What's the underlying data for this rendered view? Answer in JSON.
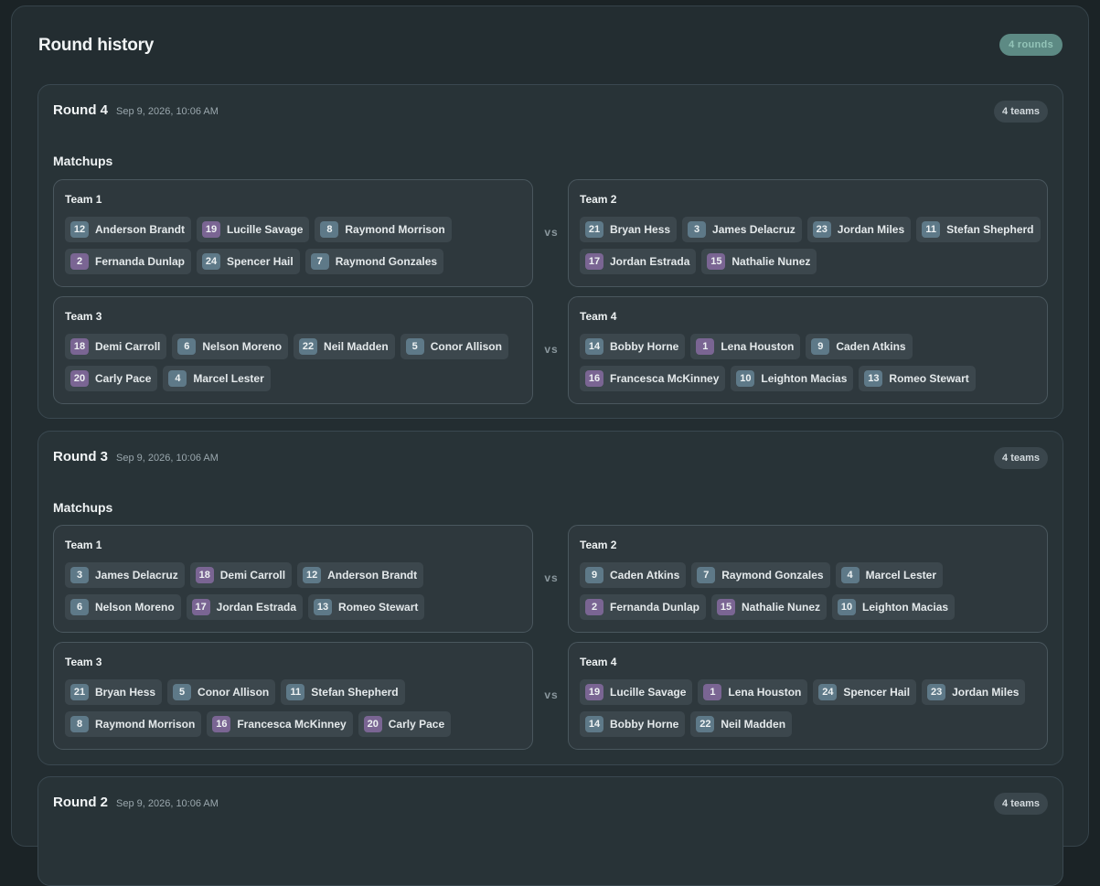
{
  "header": {
    "title": "Round history",
    "rounds_badge": "4 rounds"
  },
  "labels": {
    "matchups": "Matchups",
    "vs": "vs"
  },
  "colors": {
    "number_blue": "#5e7988",
    "number_purple": "#7a6593",
    "rounds_badge": "#5d8a84"
  },
  "rounds": [
    {
      "name": "Round 4",
      "date": "Sep 9, 2026, 10:06 AM",
      "teams_badge": "4 teams",
      "teams": [
        {
          "name": "Team 1",
          "players": [
            {
              "num": "12",
              "name": "Anderson Brandt",
              "color": "blue"
            },
            {
              "num": "19",
              "name": "Lucille Savage",
              "color": "purple"
            },
            {
              "num": "8",
              "name": "Raymond Morrison",
              "color": "blue"
            },
            {
              "num": "2",
              "name": "Fernanda Dunlap",
              "color": "purple"
            },
            {
              "num": "24",
              "name": "Spencer Hail",
              "color": "blue"
            },
            {
              "num": "7",
              "name": "Raymond Gonzales",
              "color": "blue"
            }
          ]
        },
        {
          "name": "Team 2",
          "players": [
            {
              "num": "21",
              "name": "Bryan Hess",
              "color": "blue"
            },
            {
              "num": "3",
              "name": "James Delacruz",
              "color": "blue"
            },
            {
              "num": "23",
              "name": "Jordan Miles",
              "color": "blue"
            },
            {
              "num": "11",
              "name": "Stefan Shepherd",
              "color": "blue"
            },
            {
              "num": "17",
              "name": "Jordan Estrada",
              "color": "purple"
            },
            {
              "num": "15",
              "name": "Nathalie Nunez",
              "color": "purple"
            }
          ]
        },
        {
          "name": "Team 3",
          "players": [
            {
              "num": "18",
              "name": "Demi Carroll",
              "color": "purple"
            },
            {
              "num": "6",
              "name": "Nelson Moreno",
              "color": "blue"
            },
            {
              "num": "22",
              "name": "Neil Madden",
              "color": "blue"
            },
            {
              "num": "5",
              "name": "Conor Allison",
              "color": "blue"
            },
            {
              "num": "20",
              "name": "Carly Pace",
              "color": "purple"
            },
            {
              "num": "4",
              "name": "Marcel Lester",
              "color": "blue"
            }
          ]
        },
        {
          "name": "Team 4",
          "players": [
            {
              "num": "14",
              "name": "Bobby Horne",
              "color": "blue"
            },
            {
              "num": "1",
              "name": "Lena Houston",
              "color": "purple"
            },
            {
              "num": "9",
              "name": "Caden Atkins",
              "color": "blue"
            },
            {
              "num": "16",
              "name": "Francesca McKinney",
              "color": "purple"
            },
            {
              "num": "10",
              "name": "Leighton Macias",
              "color": "blue"
            },
            {
              "num": "13",
              "name": "Romeo Stewart",
              "color": "blue"
            }
          ]
        }
      ]
    },
    {
      "name": "Round 3",
      "date": "Sep 9, 2026, 10:06 AM",
      "teams_badge": "4 teams",
      "teams": [
        {
          "name": "Team 1",
          "players": [
            {
              "num": "3",
              "name": "James Delacruz",
              "color": "blue"
            },
            {
              "num": "18",
              "name": "Demi Carroll",
              "color": "purple"
            },
            {
              "num": "12",
              "name": "Anderson Brandt",
              "color": "blue"
            },
            {
              "num": "6",
              "name": "Nelson Moreno",
              "color": "blue"
            },
            {
              "num": "17",
              "name": "Jordan Estrada",
              "color": "purple"
            },
            {
              "num": "13",
              "name": "Romeo Stewart",
              "color": "blue"
            }
          ]
        },
        {
          "name": "Team 2",
          "players": [
            {
              "num": "9",
              "name": "Caden Atkins",
              "color": "blue"
            },
            {
              "num": "7",
              "name": "Raymond Gonzales",
              "color": "blue"
            },
            {
              "num": "4",
              "name": "Marcel Lester",
              "color": "blue"
            },
            {
              "num": "2",
              "name": "Fernanda Dunlap",
              "color": "purple"
            },
            {
              "num": "15",
              "name": "Nathalie Nunez",
              "color": "purple"
            },
            {
              "num": "10",
              "name": "Leighton Macias",
              "color": "blue"
            }
          ]
        },
        {
          "name": "Team 3",
          "players": [
            {
              "num": "21",
              "name": "Bryan Hess",
              "color": "blue"
            },
            {
              "num": "5",
              "name": "Conor Allison",
              "color": "blue"
            },
            {
              "num": "11",
              "name": "Stefan Shepherd",
              "color": "blue"
            },
            {
              "num": "8",
              "name": "Raymond Morrison",
              "color": "blue"
            },
            {
              "num": "16",
              "name": "Francesca McKinney",
              "color": "purple"
            },
            {
              "num": "20",
              "name": "Carly Pace",
              "color": "purple"
            }
          ]
        },
        {
          "name": "Team 4",
          "players": [
            {
              "num": "19",
              "name": "Lucille Savage",
              "color": "purple"
            },
            {
              "num": "1",
              "name": "Lena Houston",
              "color": "purple"
            },
            {
              "num": "24",
              "name": "Spencer Hail",
              "color": "blue"
            },
            {
              "num": "23",
              "name": "Jordan Miles",
              "color": "blue"
            },
            {
              "num": "14",
              "name": "Bobby Horne",
              "color": "blue"
            },
            {
              "num": "22",
              "name": "Neil Madden",
              "color": "blue"
            }
          ]
        }
      ]
    },
    {
      "name": "Round 2",
      "date": "Sep 9, 2026, 10:06 AM",
      "teams_badge": "4 teams",
      "teams": []
    }
  ]
}
